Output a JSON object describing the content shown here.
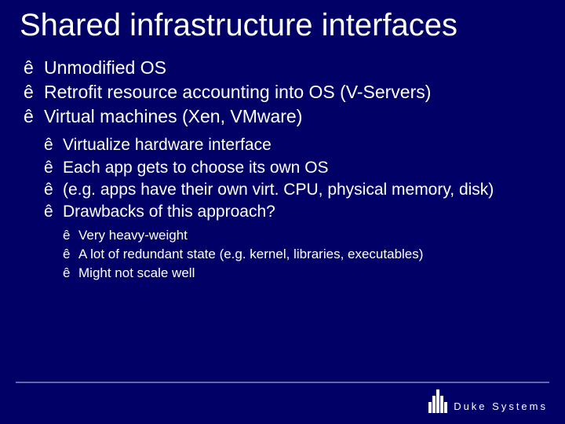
{
  "title": "Shared infrastructure interfaces",
  "l1": [
    "Unmodified OS",
    "Retrofit resource accounting into OS (V-Servers)",
    "Virtual machines (Xen, VMware)"
  ],
  "l2": [
    "Virtualize hardware interface",
    "Each app gets to choose its own OS",
    "(e.g. apps have their own virt. CPU, physical memory, disk)",
    "Drawbacks of this approach?"
  ],
  "l3": [
    "Very heavy-weight",
    "A lot of redundant state (e.g. kernel, libraries, executables)",
    "Might not scale well"
  ],
  "footer": {
    "brand": "Duke Systems"
  }
}
